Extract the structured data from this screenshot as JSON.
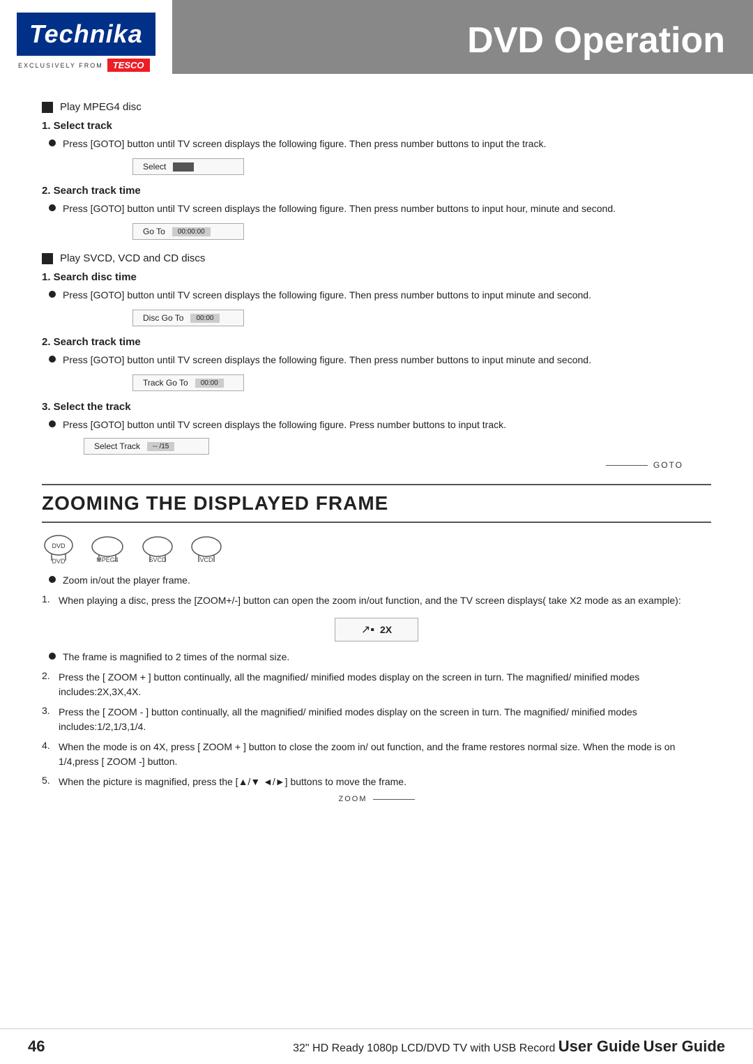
{
  "header": {
    "logo": "Technika",
    "tesco_prefix": "EXCLUSIVELY FROM",
    "tesco_brand": "TESCO",
    "page_title": "DVD Operation"
  },
  "sections": {
    "play_mpeg4": {
      "label": "Play MPEG4 disc",
      "item1": {
        "title": "1. Select track",
        "bullet": "Press [GOTO] button until TV screen displays the following figure. Then press number buttons to input the track.",
        "display": {
          "label": "Select",
          "value": ""
        }
      },
      "item2": {
        "title": "2. Search track time",
        "bullet": "Press [GOTO] button until TV screen displays the following figure. Then press number buttons to input hour, minute and second.",
        "display": {
          "label": "Go To",
          "value": "00:00:00"
        }
      }
    },
    "play_svcd": {
      "label": "Play SVCD, VCD and CD discs",
      "item1": {
        "title": "1. Search disc time",
        "bullet": "Press [GOTO] button until TV screen displays the following figure. Then press number buttons to input minute and second.",
        "display": {
          "label": "Disc Go To",
          "value": "00:00"
        }
      },
      "item2": {
        "title": "2. Search track time",
        "bullet": "Press [GOTO] button until TV screen displays the following figure. Then press number buttons to input minute and second.",
        "display": {
          "label": "Track Go To",
          "value": "00:00"
        }
      },
      "item3": {
        "title": "3. Select the track",
        "bullet": "Press [GOTO] button until TV screen displays the following figure. Press number buttons to input track.",
        "display": {
          "label": "Select Track",
          "value": "-- /15"
        }
      }
    },
    "goto_label": "GOTO"
  },
  "zooming": {
    "title": "ZOOMING THE DISPLAYED FRAME",
    "disc_icons": [
      {
        "label": "DVD"
      },
      {
        "label": "MPEG4"
      },
      {
        "label": "SVCD"
      },
      {
        "label": "VCD"
      }
    ],
    "bullet1": "Zoom in/out the player frame.",
    "items": [
      {
        "num": "1.",
        "text": "When playing a disc, press the [ZOOM+/-] button can open the zoom in/out function, and the TV screen displays( take X2 mode as an example):"
      },
      {
        "num": "",
        "text": "",
        "display": {
          "icon": "↗",
          "value": "2X"
        }
      },
      {
        "num": "",
        "text": "The frame is magnified to 2 times of the normal size.",
        "bullet": true
      },
      {
        "num": "2.",
        "text": "Press the [ ZOOM + ] button continually, all the magnified/ minified modes display on the screen in turn. The magnified/ minified modes includes:2X,3X,4X."
      },
      {
        "num": "3.",
        "text": "Press the [ ZOOM - ] button continually, all the magnified/ minified modes display on the screen in turn. The magnified/ minified modes includes:1/2,1/3,1/4."
      },
      {
        "num": "4.",
        "text": "When the mode is on 4X, press [ ZOOM + ] button to close the zoom in/ out function, and the frame restores normal size. When the mode is on 1/4,press [ ZOOM -] button."
      },
      {
        "num": "5.",
        "text": "When the picture is magnified, press the [▲/▼ ◄/►] buttons to move the frame."
      }
    ],
    "zoom_note": "ZOOM"
  },
  "footer": {
    "page_number": "46",
    "device_description": "32\" HD Ready 1080p LCD/DVD TV with USB Record",
    "user_guide_label": "User Guide"
  }
}
